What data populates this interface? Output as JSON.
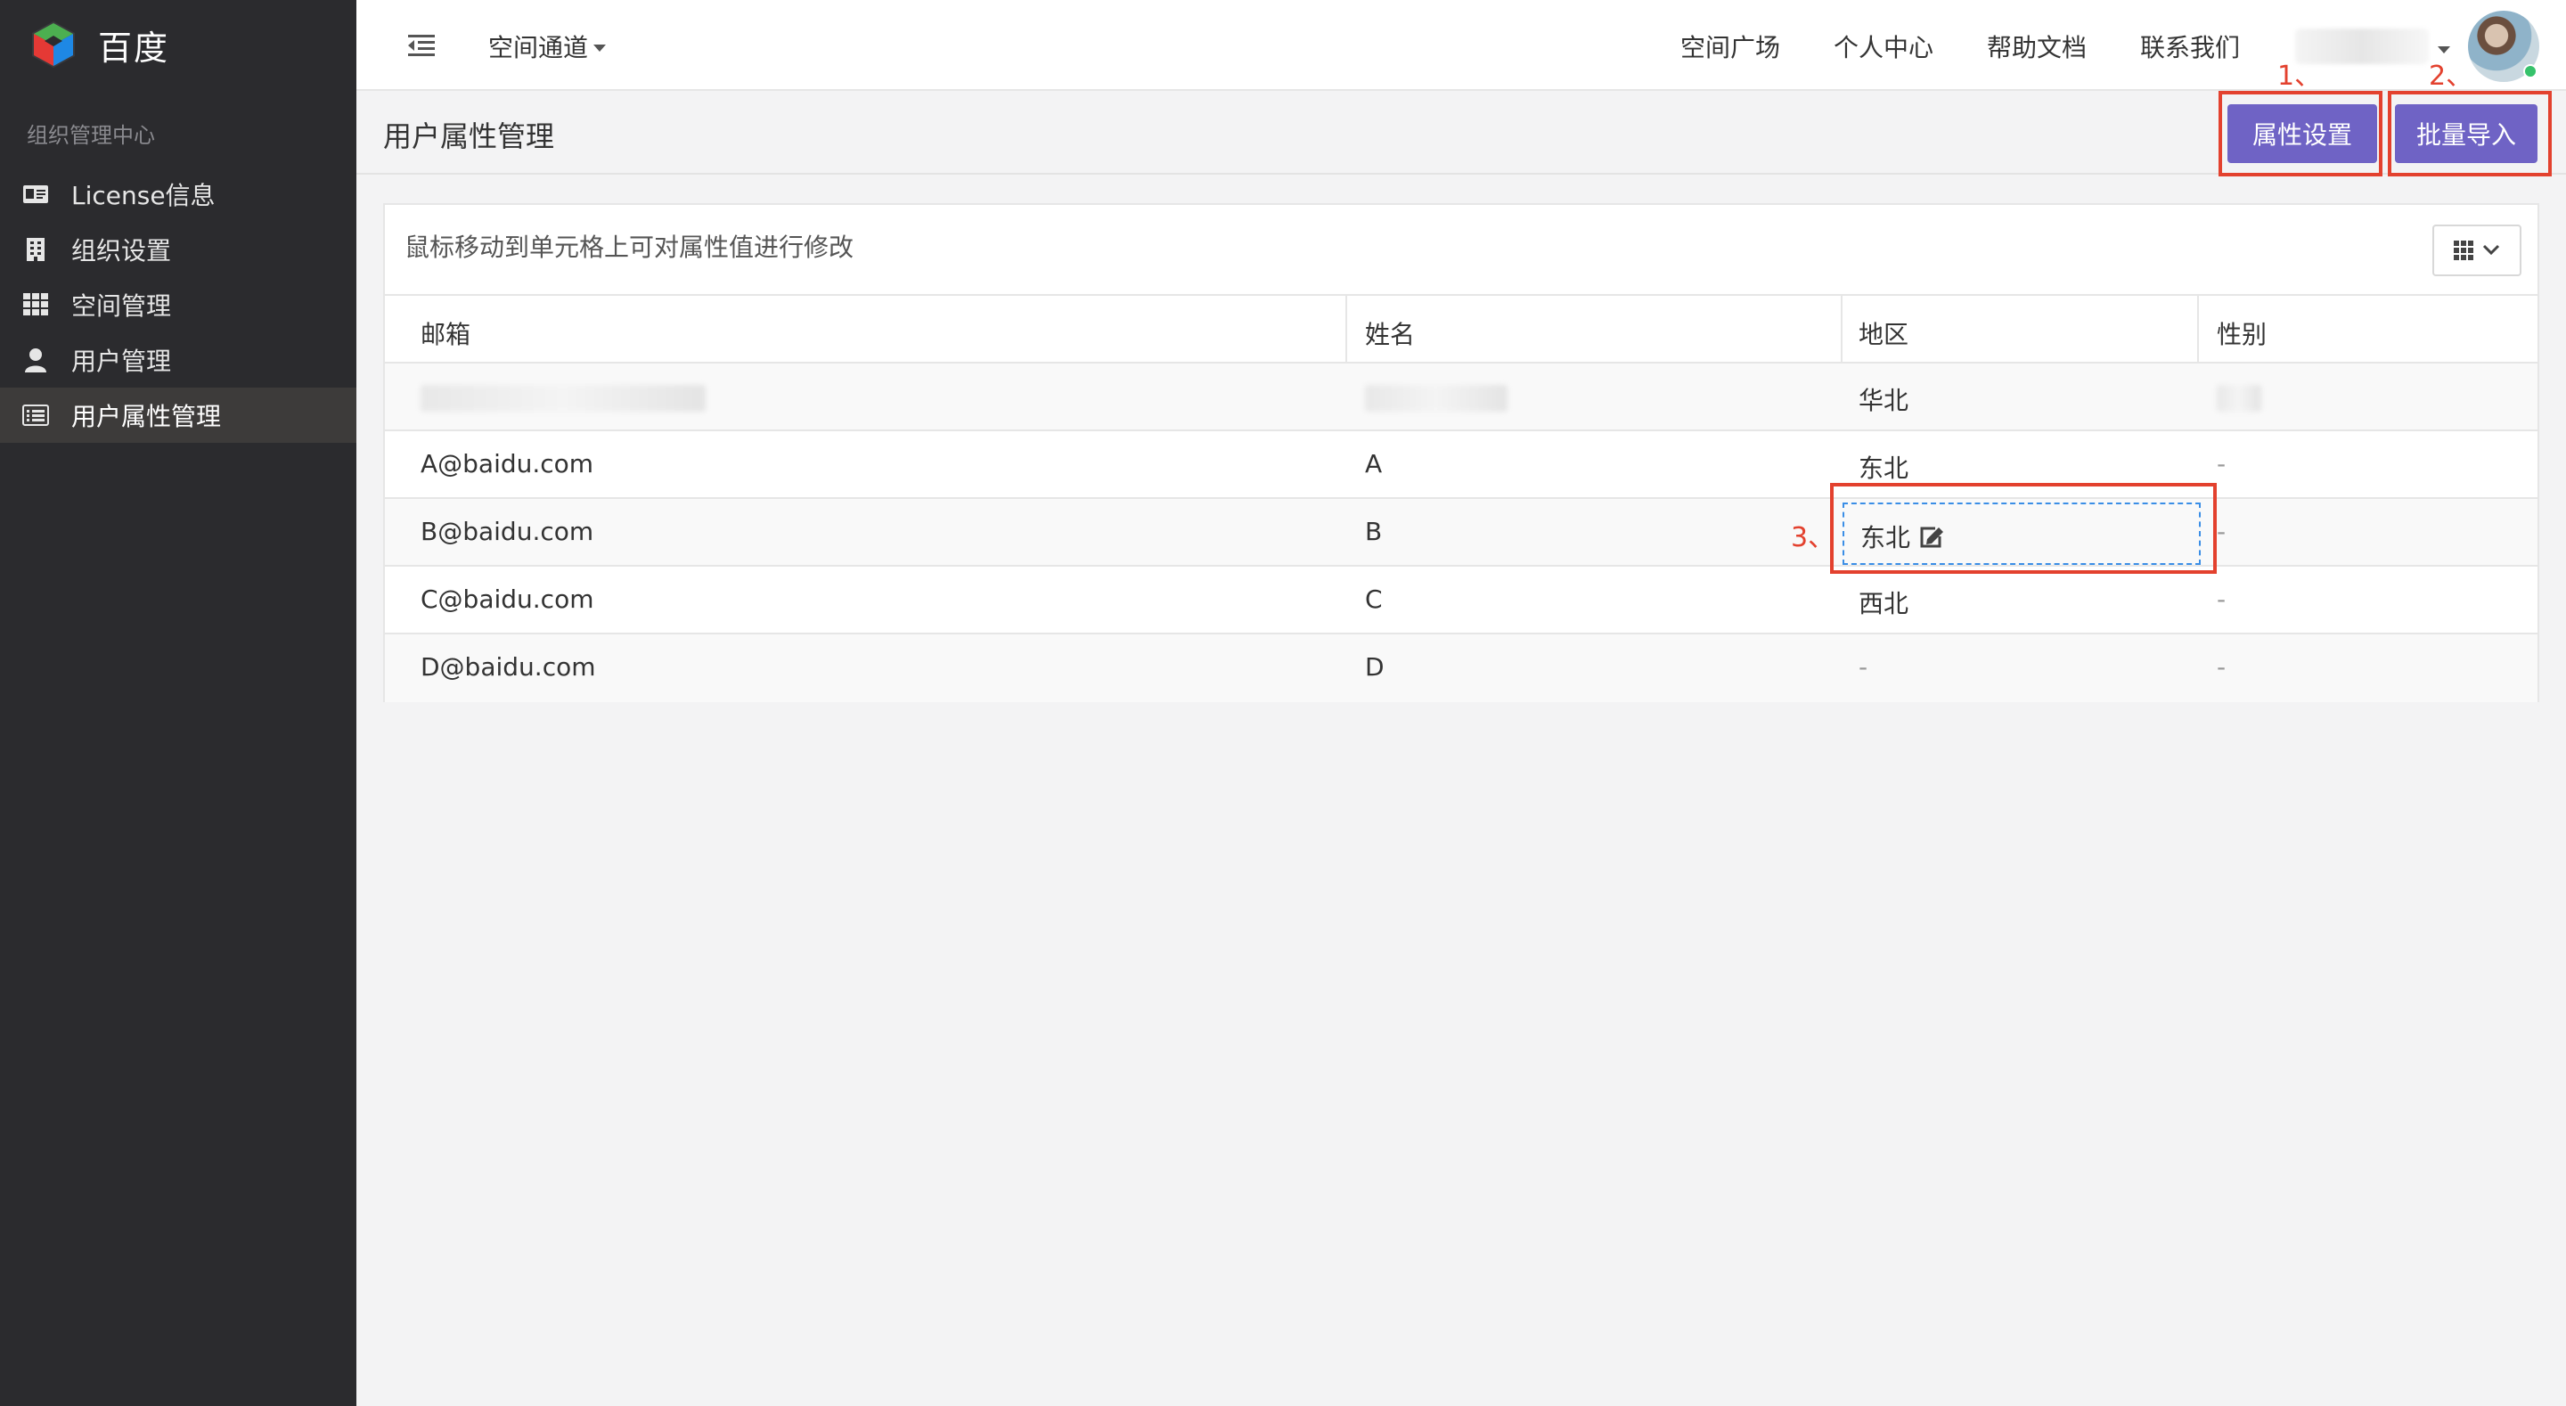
{
  "brand": {
    "name": "百度",
    "logo_icon": "hexagon-cube-logo"
  },
  "sidebar": {
    "section_title": "组织管理中心",
    "items": [
      {
        "label": "License信息",
        "icon": "id-card-icon",
        "active": false
      },
      {
        "label": "组织设置",
        "icon": "building-icon",
        "active": false
      },
      {
        "label": "空间管理",
        "icon": "grid-icon",
        "active": false
      },
      {
        "label": "用户管理",
        "icon": "user-icon",
        "active": false
      },
      {
        "label": "用户属性管理",
        "icon": "list-icon",
        "active": true
      }
    ]
  },
  "topbar": {
    "space_menu": "空间通道",
    "links": [
      "空间广场",
      "个人中心",
      "帮助文档",
      "联系我们"
    ]
  },
  "page": {
    "title": "用户属性管理",
    "buttons": {
      "attr_settings": "属性设置",
      "batch_import": "批量导入"
    }
  },
  "annotations": [
    "1、",
    "2、",
    "3、"
  ],
  "table": {
    "hint": "鼠标移动到单元格上可对属性值进行修改",
    "headers": [
      "邮箱",
      "姓名",
      "地区",
      "性别"
    ],
    "rows": [
      {
        "email": "",
        "name": "",
        "region": "华北",
        "gender": ""
      },
      {
        "email": "A@baidu.com",
        "name": "A",
        "region": "东北",
        "gender": "-"
      },
      {
        "email": "B@baidu.com",
        "name": "B",
        "region": "东北",
        "gender": "-"
      },
      {
        "email": "C@baidu.com",
        "name": "C",
        "region": "西北",
        "gender": "-"
      },
      {
        "email": "D@baidu.com",
        "name": "D",
        "region": "-",
        "gender": "-"
      }
    ]
  },
  "colors": {
    "sidebar_bg": "#2b2b2e",
    "primary_button": "#6f63c5",
    "annotation_red": "#e3412e",
    "edit_border": "#3a8ee6"
  }
}
